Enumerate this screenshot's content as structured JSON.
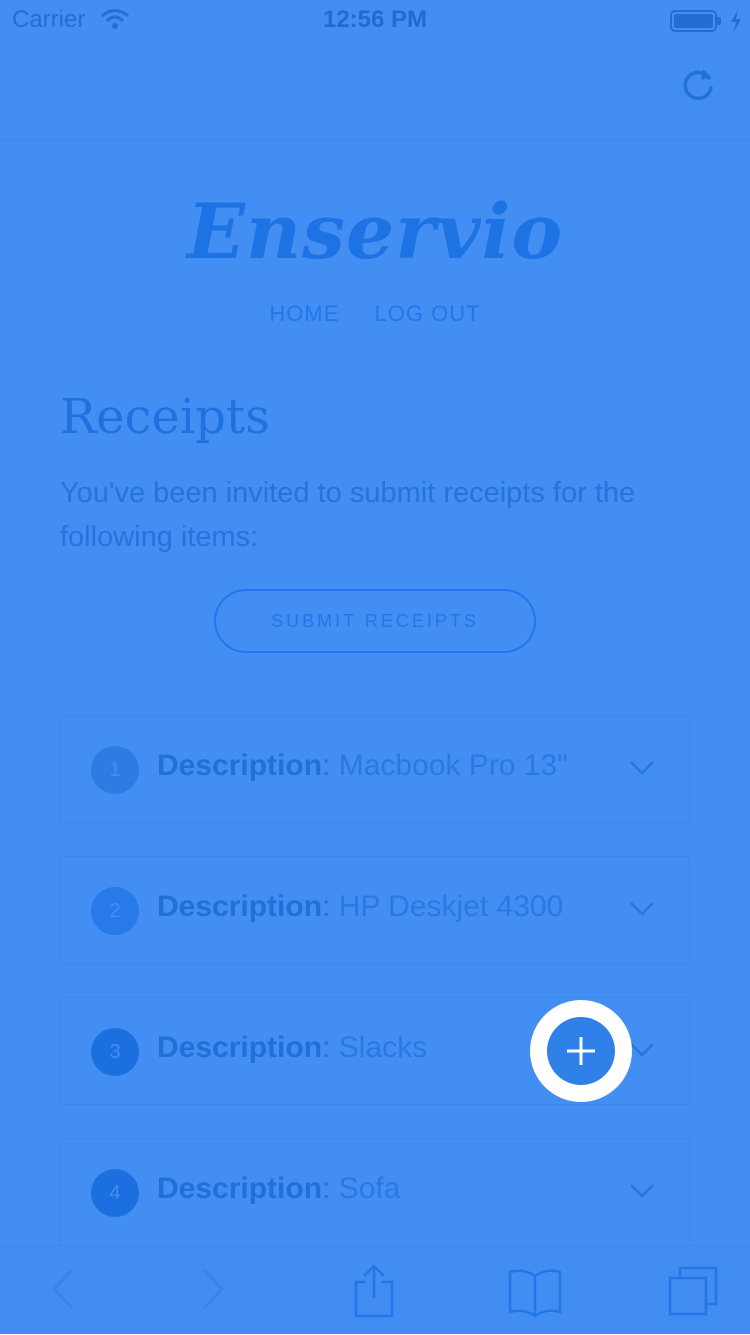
{
  "status_bar": {
    "carrier": "Carrier",
    "time": "12:56 PM"
  },
  "browser": {
    "reload_icon": "reload-icon"
  },
  "page": {
    "logo": "Enservio",
    "nav": {
      "home": "HOME",
      "logout": "LOG OUT"
    },
    "title": "Receipts",
    "intro": "You've been invited to submit receipts for the following items:",
    "submit_button": "SUBMIT RECEIPTS",
    "receipts": [
      {
        "number": "1",
        "label": "Description",
        "value": "Macbook Pro 13\""
      },
      {
        "number": "2",
        "label": "Description",
        "value": "HP Deskjet 4300"
      },
      {
        "number": "3",
        "label": "Description",
        "value": "Slacks"
      },
      {
        "number": "4",
        "label": "Description",
        "value": "Sofa"
      }
    ]
  },
  "toolbar": {
    "icons": [
      "back-icon",
      "forward-icon",
      "share-icon",
      "bookmarks-icon",
      "tabs-icon"
    ]
  },
  "colors": {
    "overlay": "#1e78f0",
    "fab": "#2f80e8",
    "accent": "#2f6fd0"
  }
}
